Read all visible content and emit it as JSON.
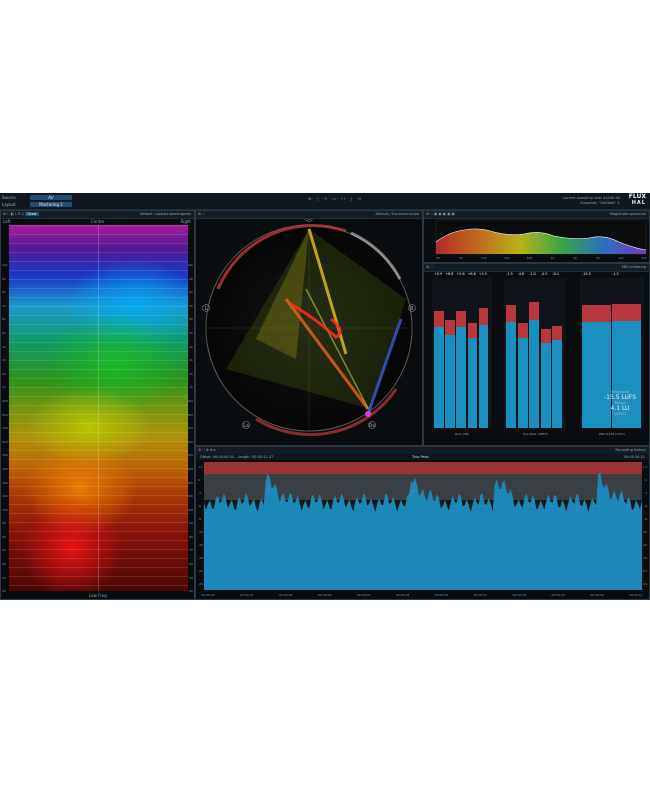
{
  "topbar": {
    "source_label": "Source",
    "source_value": "Air",
    "layout_label": "Layout",
    "layout_value": "Mastering 2",
    "sample_rate": "Current sampling rate: 44100 Hz",
    "snapshot": "Snapshot: \"Untitled\" ↕",
    "logo_top": "FLUX",
    "logo_bottom": "HAL"
  },
  "spectrogram": {
    "title": "Default / spatial spectrogram",
    "left": "Left",
    "center": "Center",
    "right": "Right",
    "bottom": "Low Freq",
    "mode": "Draw",
    "tick_labels": [
      "10k",
      "9k",
      "8k",
      "7k",
      "6k",
      "5k",
      "4k",
      "3k",
      "2k",
      "1k",
      "900",
      "800",
      "700",
      "600",
      "500",
      "400",
      "300",
      "200",
      "100",
      "90",
      "80",
      "70",
      "60",
      "50",
      "40",
      "30",
      "20"
    ]
  },
  "vectorscope": {
    "title": "Default / Surround scope",
    "labels": [
      "C",
      "L",
      "R",
      "Ls",
      "Rs"
    ]
  },
  "magnitude": {
    "title": "Magnitude spectrum",
    "freq_labels": [
      "20",
      "50",
      "100",
      "200",
      "500",
      "1k",
      "2k",
      "5k",
      "10k",
      "20k"
    ]
  },
  "meters": {
    "title": "EBU metering",
    "groups": [
      {
        "name": "Rms (dB)",
        "readouts": [
          "+5.9",
          "+6.8",
          "+5.6",
          "+6.8",
          "+5.5"
        ],
        "levels": [
          0.78,
          0.72,
          0.78,
          0.7,
          0.8
        ]
      },
      {
        "name": "True Peak (dBTP)",
        "readouts": [
          "-1.9",
          "-4.8",
          "-1.0",
          "-4.5",
          "-6.1"
        ],
        "levels": [
          0.82,
          0.7,
          0.84,
          0.66,
          0.68
        ]
      },
      {
        "name": "EBU R128 (LUFS)",
        "readouts": [
          "-15.5",
          "-1.5"
        ],
        "levels": [
          0.82,
          0.83
        ]
      }
    ],
    "integrated_label": "Integrated",
    "integrated_value": "-15.5 LUFS",
    "range_label": "Range",
    "range_value": "4.1 LU",
    "status": "GATED"
  },
  "truepeak": {
    "offset": "Offset: 00:00:00.00 - Length: 00:00:11.47",
    "title": "True Peak",
    "timecode": "00:00:16.11",
    "mode": "Recording history",
    "time_labels": [
      "00:00:00",
      "00:00:01",
      "00:00:02",
      "00:00:03",
      "00:00:04",
      "00:00:05",
      "00:00:06",
      "00:00:07",
      "00:00:08",
      "00:00:09",
      "00:00:10",
      "00:00:11"
    ],
    "db_labels": [
      "+3",
      "0",
      "-3",
      "-6",
      "-9",
      "-12",
      "-15",
      "-18",
      "-21",
      "-24"
    ]
  },
  "colors": {
    "accent": "#1a8fc0",
    "peak_red": "#b8373c",
    "panel_bg": "#0a0d10"
  }
}
